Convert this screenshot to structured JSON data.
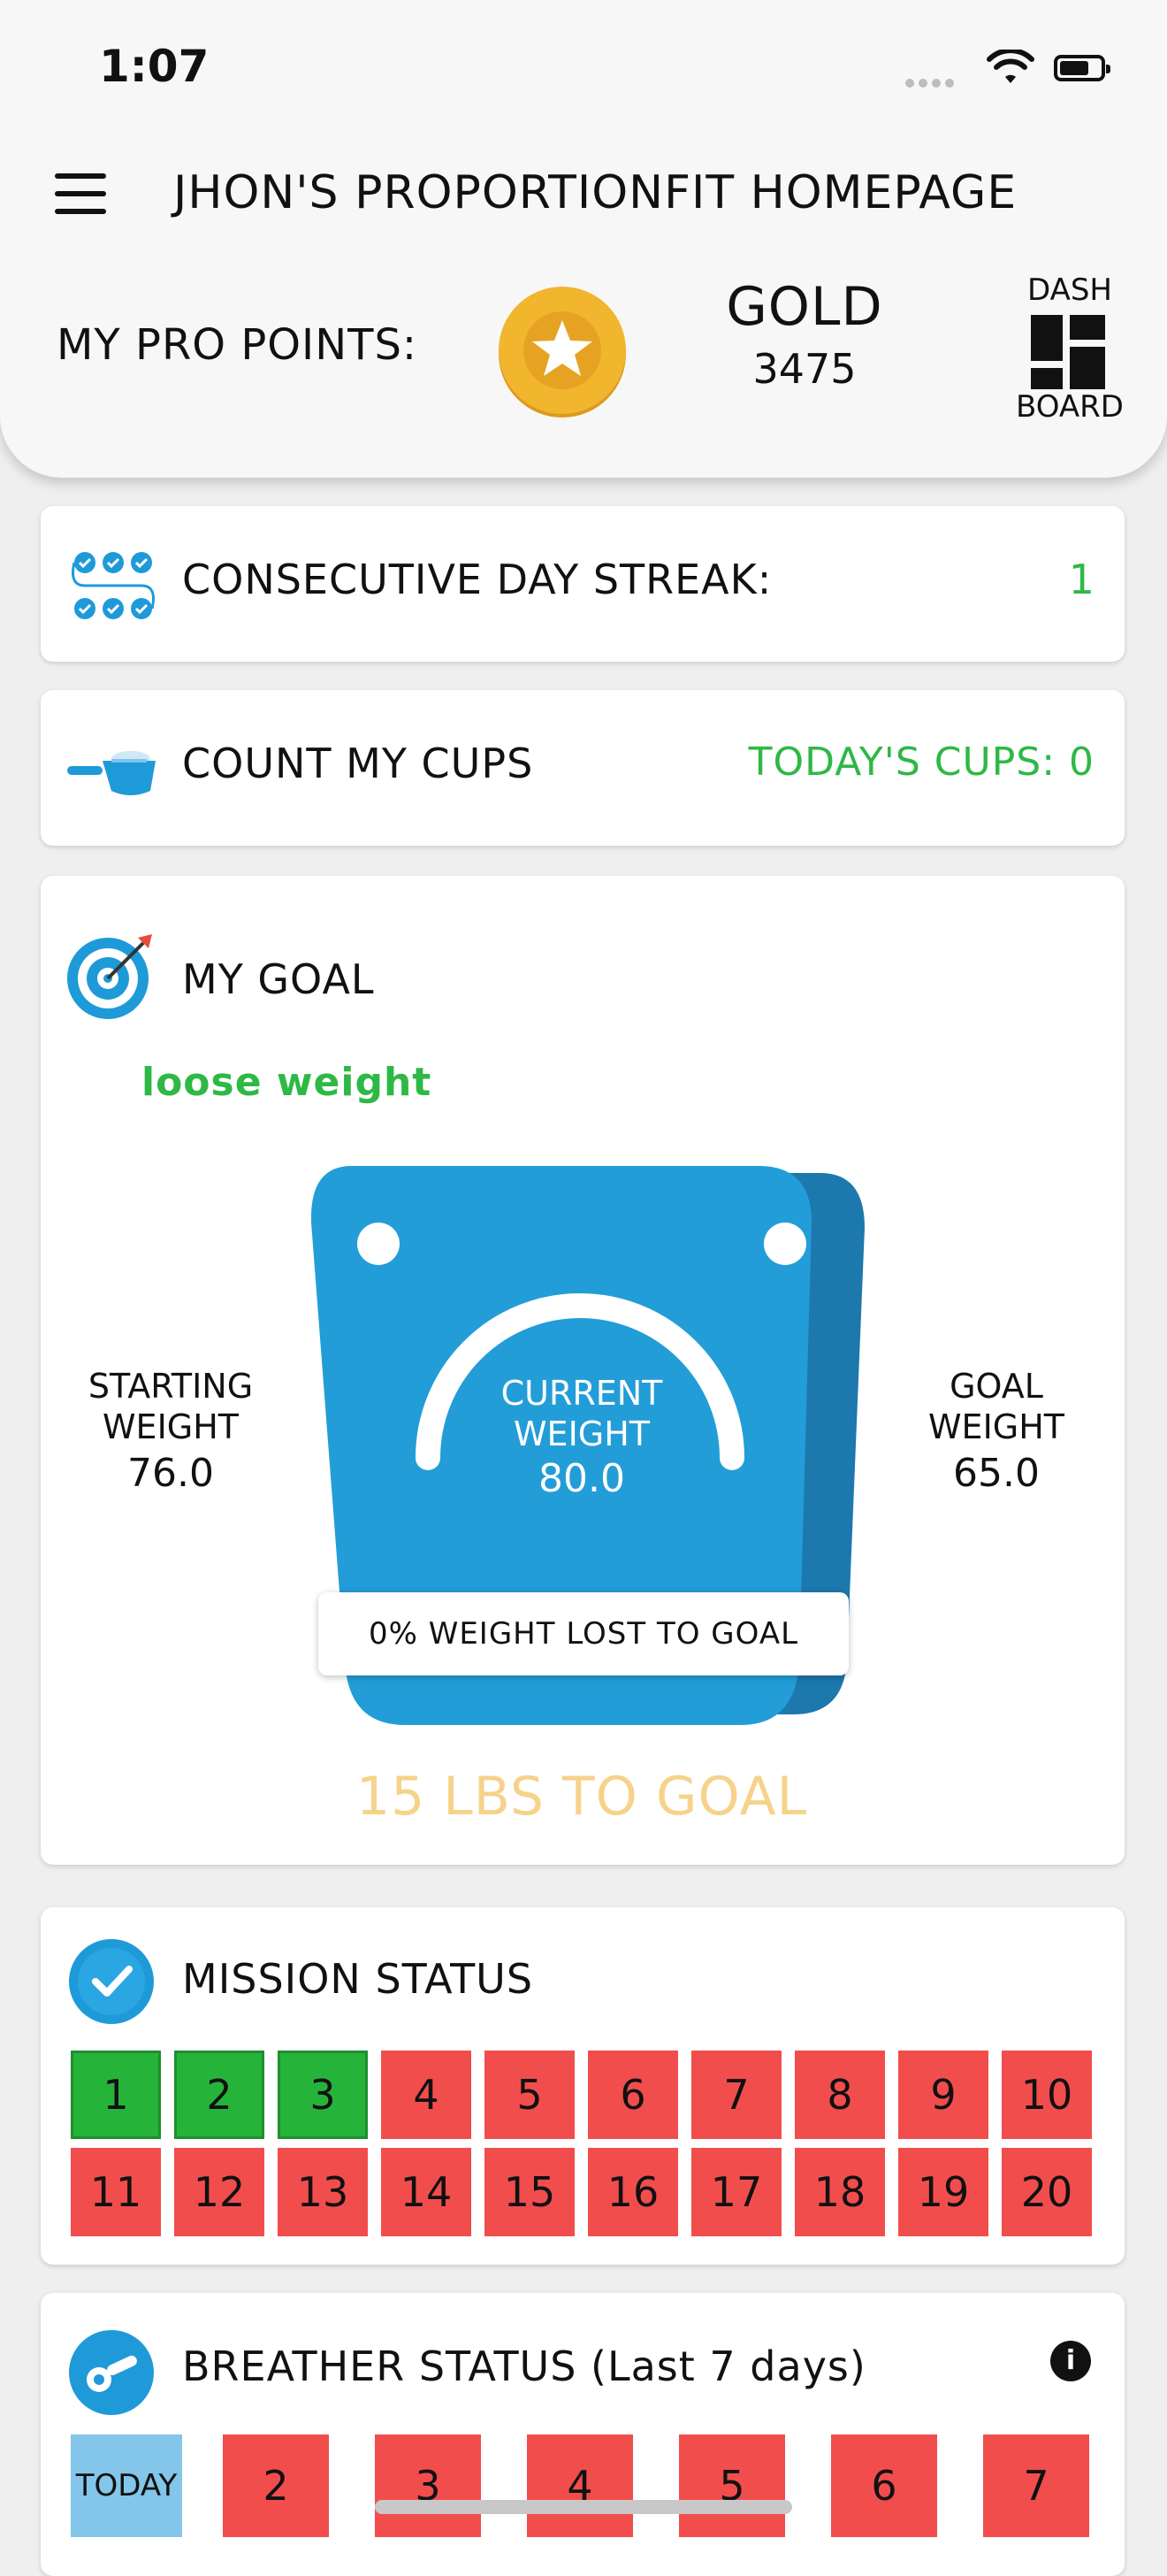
{
  "status_bar": {
    "time": "1:07"
  },
  "header": {
    "title": "JHON'S PROPORTIONFIT HOMEPAGE",
    "points_label": "MY PRO POINTS:",
    "tier": "GOLD",
    "points": "3475",
    "dashboard_top": "DASH",
    "dashboard_bottom": "BOARD"
  },
  "streak": {
    "label": "CONSECUTIVE DAY STREAK:",
    "value": "1"
  },
  "cups": {
    "label": "COUNT MY CUPS",
    "today": "TODAY'S CUPS: 0"
  },
  "goal": {
    "title": "MY GOAL",
    "subtitle": "loose weight",
    "starting_label_1": "STARTING",
    "starting_label_2": "WEIGHT",
    "starting_value": "76.0",
    "current_label_1": "CURRENT",
    "current_label_2": "WEIGHT",
    "current_value": "80.0",
    "goal_label_1": "GOAL",
    "goal_label_2": "WEIGHT",
    "goal_value": "65.0",
    "progress_text": "0% WEIGHT LOST TO GOAL",
    "progress_fraction": 0,
    "remaining_text": "15 LBS TO GOAL"
  },
  "mission": {
    "title": "MISSION STATUS",
    "days": [
      {
        "label": "1",
        "done": true
      },
      {
        "label": "2",
        "done": true
      },
      {
        "label": "3",
        "done": true
      },
      {
        "label": "4",
        "done": false
      },
      {
        "label": "5",
        "done": false
      },
      {
        "label": "6",
        "done": false
      },
      {
        "label": "7",
        "done": false
      },
      {
        "label": "8",
        "done": false
      },
      {
        "label": "9",
        "done": false
      },
      {
        "label": "10",
        "done": false
      },
      {
        "label": "11",
        "done": false
      },
      {
        "label": "12",
        "done": false
      },
      {
        "label": "13",
        "done": false
      },
      {
        "label": "14",
        "done": false
      },
      {
        "label": "15",
        "done": false
      },
      {
        "label": "16",
        "done": false
      },
      {
        "label": "17",
        "done": false
      },
      {
        "label": "18",
        "done": false
      },
      {
        "label": "19",
        "done": false
      },
      {
        "label": "20",
        "done": false
      }
    ]
  },
  "breather": {
    "title": "BREATHER STATUS (Last 7 days)",
    "info_glyph": "i",
    "days": [
      "TODAY",
      "2",
      "3",
      "4",
      "5",
      "6",
      "7"
    ]
  },
  "colors": {
    "accent_blue": "#1f9ad8",
    "success_green": "#2eb845",
    "incomplete_red": "#f24d4d",
    "gold": "#f1b52e",
    "today_blue": "#84c5ea",
    "remaining_text": "#f6d28a"
  },
  "icons": {
    "menu": "hamburger-icon",
    "points": "gold-star-coin-icon",
    "dashboard": "grid-icon",
    "streak": "linked-checks-icon",
    "cups": "measuring-scoop-icon",
    "goal": "target-arrow-icon",
    "mission": "checkmark-icon",
    "breather": "breather-device-icon",
    "info": "info-icon"
  }
}
